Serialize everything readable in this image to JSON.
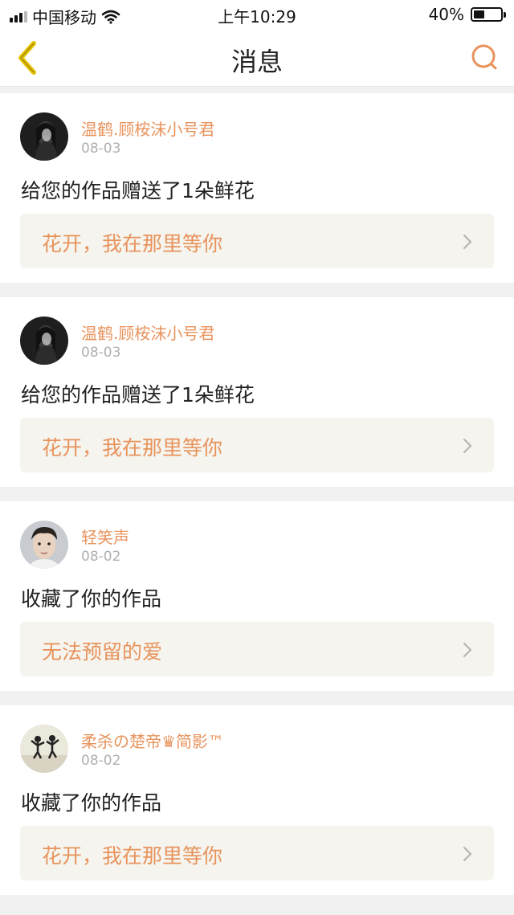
{
  "status_bar": {
    "carrier": "中国移动",
    "time": "上午10:29",
    "battery_percent": "40%",
    "battery_level": 0.4,
    "icons": [
      "signal-icon",
      "wifi-icon",
      "battery-icon"
    ]
  },
  "nav": {
    "title": "消息",
    "back_icon": "chevron-left-icon",
    "search_icon": "search-icon",
    "accent_color": "#e8935c",
    "back_color": "#e7c400"
  },
  "messages": [
    {
      "user": "温鹤.顾桉沫小号君",
      "date": "08-03",
      "action": "给您的作品赠送了1朵鲜花",
      "work": "花开，我在那里等你",
      "avatar": "dark-portrait"
    },
    {
      "user": "温鹤.顾桉沫小号君",
      "date": "08-03",
      "action": "给您的作品赠送了1朵鲜花",
      "work": "花开，我在那里等你",
      "avatar": "dark-portrait"
    },
    {
      "user": "轻笑声",
      "date": "08-02",
      "action": "收藏了你的作品",
      "work": "无法预留的爱",
      "avatar": "face-portrait"
    },
    {
      "user": "柔杀の楚帝♛简影™",
      "date": "08-02",
      "action": "收藏了你的作品",
      "work": "花开，我在那里等你",
      "avatar": "figures-photo"
    }
  ]
}
